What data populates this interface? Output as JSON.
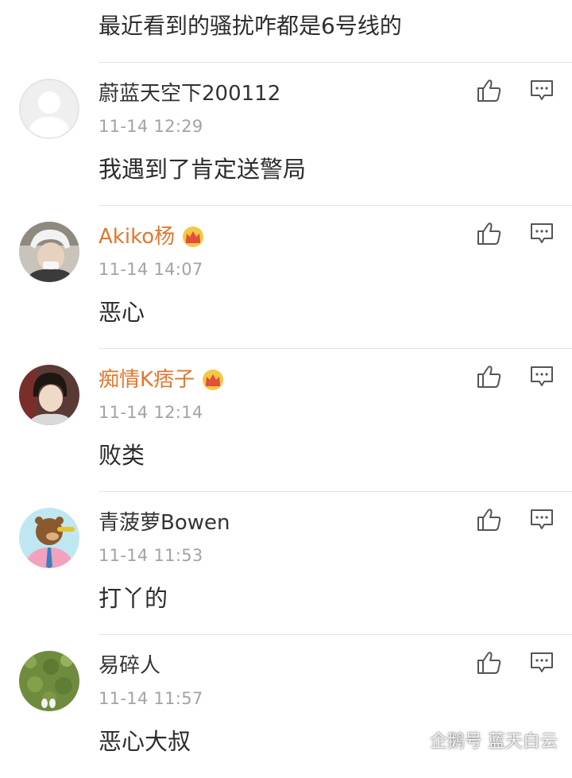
{
  "top_comment": {
    "text": "最近看到的骚扰咋都是6号线的"
  },
  "comments": [
    {
      "username": "蔚蓝天空下200112",
      "vip": false,
      "time": "11-14 12:29",
      "text": "我遇到了肯定送警局",
      "avatar": "default-avatar"
    },
    {
      "username": "Akiko杨",
      "vip": true,
      "time": "11-14 14:07",
      "text": "恶心",
      "avatar": "photo-avatar"
    },
    {
      "username": "痴情K痞子",
      "vip": true,
      "time": "11-14 12:14",
      "text": "败类",
      "avatar": "photo-avatar"
    },
    {
      "username": "青菠萝Bowen",
      "vip": false,
      "time": "11-14 11:53",
      "text": "打丫的",
      "avatar": "cartoon-bear-avatar"
    },
    {
      "username": "易碎人",
      "vip": false,
      "time": "11-14 11:57",
      "text": "恶心大叔",
      "avatar": "grass-photo-avatar"
    }
  ],
  "icons": {
    "like": "thumbs-up-icon",
    "reply": "comment-bubble-icon",
    "vip": "crown-icon"
  },
  "colors": {
    "vip_name": "#e0782e",
    "time": "#a3a3a3",
    "divider": "#e3e3e3"
  },
  "watermark": {
    "text": "企鹅号 蓝天白云"
  }
}
